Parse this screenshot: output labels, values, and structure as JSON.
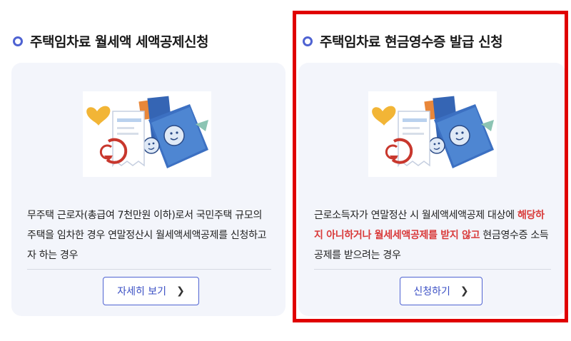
{
  "left": {
    "title": "주택임차료 월세액 세액공제신청",
    "desc": "무주택 근로자(총급여 7천만원 이하)로서 국민주택 규모의 주택을 임차한 경우 연말정산시 월세액세액공제를 신청하고자 하는 경우",
    "button_label": "자세히 보기",
    "button_icon": "chevron-right-icon"
  },
  "right": {
    "title": "주택임차료 현금영수증 발급 신청",
    "desc_part1": "근로소득자가 연말정산 시 월세액세액공제 대상에 ",
    "desc_highlight": "해당하지 아니하거나 월세세액공제를 받지 않고",
    "desc_part2": " 현금영수증 소득공제를 받으려는 경우",
    "button_label": "신청하기",
    "button_icon": "chevron-right-icon"
  },
  "colors": {
    "accent": "#4f63d2",
    "highlight_text": "#d93a3a",
    "card_bg": "#f3f5fb",
    "selection_border": "#e00000"
  }
}
